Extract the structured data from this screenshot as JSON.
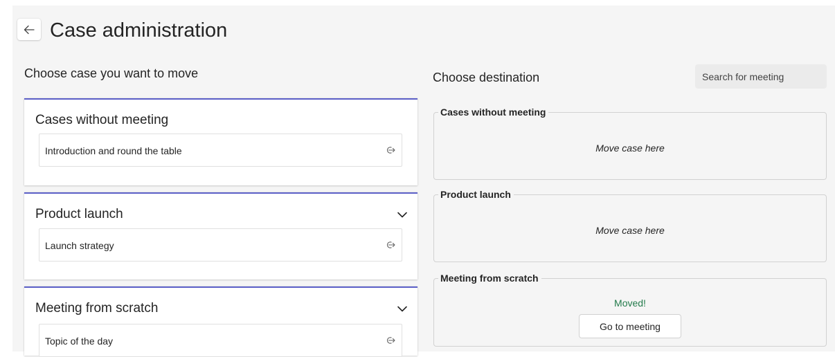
{
  "header": {
    "title": "Case administration",
    "back_icon": "arrow-left-icon"
  },
  "source": {
    "heading": "Choose case you want to move",
    "groups": [
      {
        "title": "Cases without meeting",
        "has_chevron": false,
        "items": [
          {
            "label": "Introduction and round the table",
            "icon": "move-arrow-icon"
          }
        ]
      },
      {
        "title": "Product launch",
        "has_chevron": true,
        "items": [
          {
            "label": "Launch strategy",
            "icon": "move-arrow-icon"
          }
        ]
      },
      {
        "title": "Meeting from scratch",
        "has_chevron": true,
        "items": [
          {
            "label": "Topic of the day",
            "icon": "move-arrow-icon"
          }
        ]
      }
    ]
  },
  "destination": {
    "heading": "Choose destination",
    "search_placeholder": "Search for meeting",
    "groups": [
      {
        "title": "Cases without meeting",
        "drop_label": "Move case here"
      },
      {
        "title": "Product launch",
        "drop_label": "Move case here"
      },
      {
        "title": "Meeting from scratch",
        "status": "Moved!",
        "button_label": "Go to meeting"
      }
    ]
  },
  "colors": {
    "accent": "#5b5fc7",
    "success": "#237b4b",
    "page_background": "#f5f5f5"
  }
}
